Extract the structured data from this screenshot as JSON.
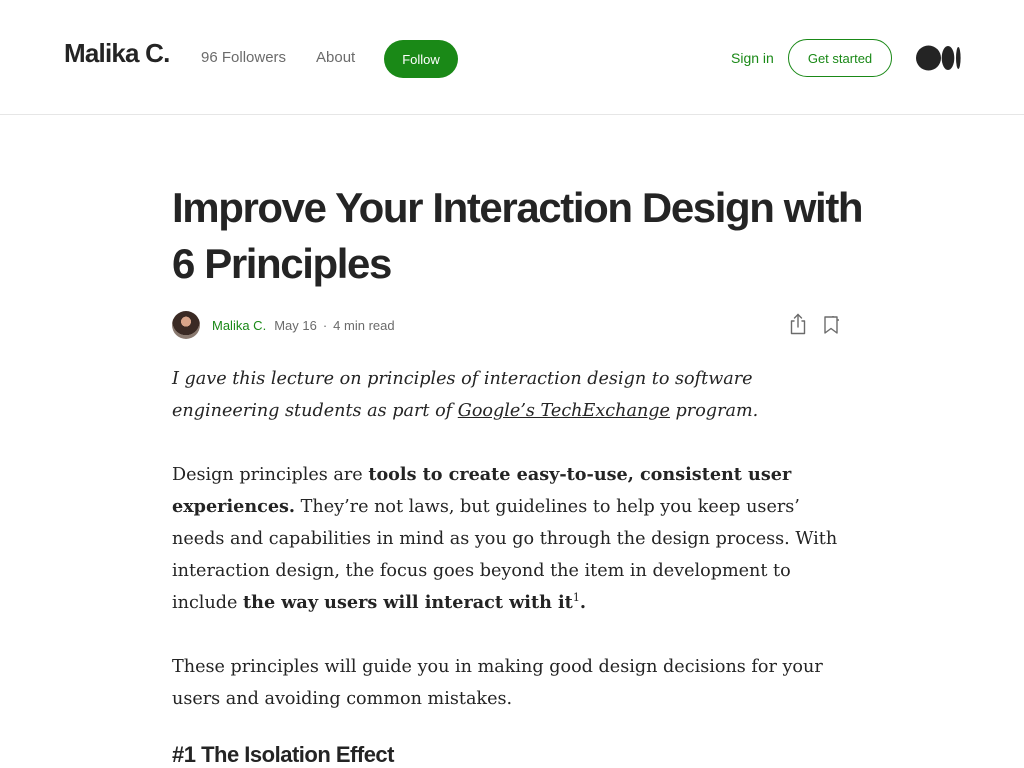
{
  "header": {
    "brand": "Malika C.",
    "followers": "96 Followers",
    "about": "About",
    "follow": "Follow",
    "sign_in": "Sign in",
    "get_started": "Get started"
  },
  "colors": {
    "accent": "#1a8917",
    "text": "#242424",
    "muted": "#6b6b6b"
  },
  "article": {
    "title": "Improve Your Interaction Design with 6 Principles",
    "author": "Malika C.",
    "date": "May 16",
    "separator": "·",
    "read_time": "4 min read",
    "intro_before": "I gave this lecture on principles of interaction design to software engineering students as part of ",
    "intro_link": "Google’s TechExchange",
    "intro_after": " program.",
    "p1_a": "Design principles are ",
    "p1_b": "tools to create easy-to-use, consistent user experiences.",
    "p1_c": " They’re not laws, but guidelines to help you keep users’ needs and capabilities in mind as you go through the design process. With interaction design, the focus goes beyond the item in development to include ",
    "p1_d": "the way users will interact with it",
    "p1_sup": "1",
    "p1_e": ".",
    "p2": "These principles will guide you in making good design decisions for your users and avoiding common mistakes.",
    "h2": "#1 The Isolation Effect"
  },
  "icons": [
    "medium-logo-icon",
    "share-icon",
    "bookmark-icon"
  ]
}
